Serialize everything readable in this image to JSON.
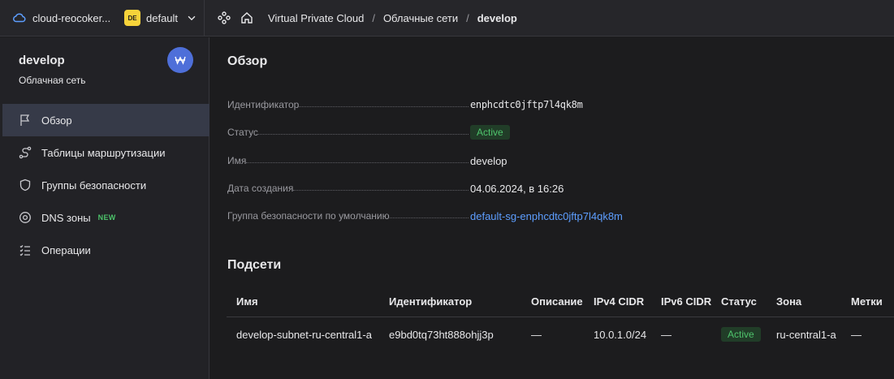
{
  "topbar": {
    "cloud_name": "cloud-reocoker...",
    "folder_badge": "DE",
    "folder_name": "default",
    "breadcrumbs": [
      "Virtual Private Cloud",
      "Облачные сети",
      "develop"
    ],
    "separator": "/"
  },
  "sidebar": {
    "title": "develop",
    "subtitle": "Облачная сеть",
    "items": [
      {
        "label": "Обзор",
        "icon": "flag-icon",
        "active": true
      },
      {
        "label": "Таблицы маршрутизации",
        "icon": "route-icon"
      },
      {
        "label": "Группы безопасности",
        "icon": "shield-icon"
      },
      {
        "label": "DNS зоны",
        "icon": "globe-icon",
        "badge": "NEW"
      },
      {
        "label": "Операции",
        "icon": "list-icon"
      }
    ]
  },
  "overview": {
    "title": "Обзор",
    "rows": [
      {
        "key": "Идентификатор",
        "value": "enphcdtc0jftp7l4qk8m"
      },
      {
        "key": "Статус",
        "value": "Active"
      },
      {
        "key": "Имя",
        "value": "develop"
      },
      {
        "key": "Дата создания",
        "value": "04.06.2024, в 16:26"
      },
      {
        "key": "Группа безопасности по умолчанию",
        "value": "default-sg-enphcdtc0jftp7l4qk8m"
      }
    ]
  },
  "subnets": {
    "title": "Подсети",
    "columns": [
      "Имя",
      "Идентификатор",
      "Описание",
      "IPv4 CIDR",
      "IPv6 CIDR",
      "Статус",
      "Зона",
      "Метки"
    ],
    "rows": [
      [
        "develop-subnet-ru-central1-a",
        "e9bd0tq73ht888ohjj3p",
        "—",
        "10.0.1.0/24",
        "—",
        "Active",
        "ru-central1-a",
        "—"
      ]
    ]
  },
  "colors": {
    "accent": "#5d9eff",
    "status_active": "#4fc46c",
    "avatar": "#4e6fd9",
    "folder_badge": "#f7d33a"
  }
}
